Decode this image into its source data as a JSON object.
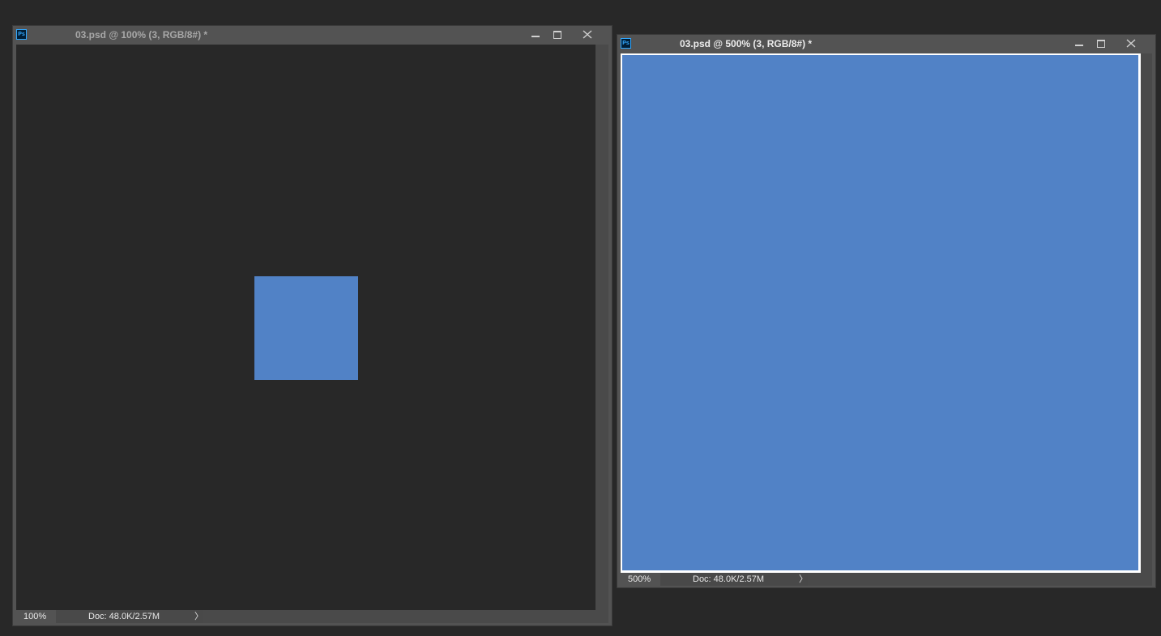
{
  "windows": [
    {
      "title": "03.psd @ 100% (3, RGB/8#) *",
      "active": false,
      "icon": "ps-app-icon",
      "icon_label": "Ps",
      "zoom": "100%",
      "doc_info": "Doc: 48.0K/2.57M",
      "canvas_color": "#5182c6"
    },
    {
      "title": "03.psd @ 500% (3, RGB/8#) *",
      "active": true,
      "icon": "ps-app-icon",
      "icon_label": "Ps",
      "zoom": "500%",
      "doc_info": "Doc: 48.0K/2.57M",
      "canvas_color": "#5182c6"
    }
  ],
  "controls": {
    "minimize": "minimize-icon",
    "maximize": "maximize-icon",
    "close": "close-icon",
    "arrow": "〉"
  },
  "colors": {
    "workspace_bg": "#282828",
    "panel": "#535353",
    "document_fill": "#5182c6",
    "ps_accent": "#31a8ff"
  }
}
